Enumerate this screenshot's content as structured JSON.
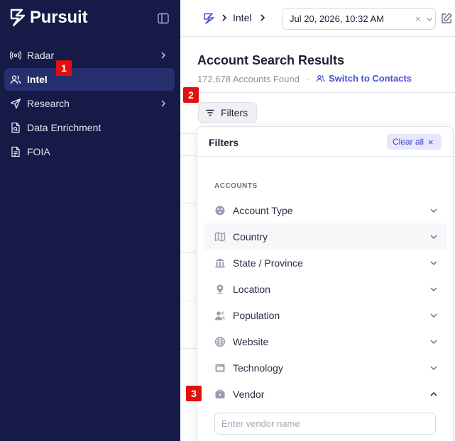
{
  "brand": {
    "name": "Pursuit"
  },
  "sidebar": {
    "items": [
      {
        "label": "Radar"
      },
      {
        "label": "Intel"
      },
      {
        "label": "Research"
      },
      {
        "label": "Data Enrichment"
      },
      {
        "label": "FOIA"
      }
    ]
  },
  "topbar": {
    "breadcrumb": "Intel",
    "date_value": "Jul 20, 2026, 10:32 AM",
    "date_clear": "×"
  },
  "main": {
    "title": "Account Search Results",
    "count": "172,678 Accounts Found",
    "separator": "·",
    "switch_link": "Switch to Contacts",
    "filters_button": "Filters"
  },
  "panel": {
    "title": "Filters",
    "clear_all": "Clear all",
    "clear_icon": "×",
    "section": "ACCOUNTS",
    "rows": [
      {
        "label": "Account Type",
        "icon": "account-type-icon"
      },
      {
        "label": "Country",
        "icon": "map-icon"
      },
      {
        "label": "State / Province",
        "icon": "building-icon"
      },
      {
        "label": "Location",
        "icon": "location-pin-icon"
      },
      {
        "label": "Population",
        "icon": "population-icon"
      },
      {
        "label": "Website",
        "icon": "globe-icon"
      },
      {
        "label": "Technology",
        "icon": "technology-icon"
      },
      {
        "label": "Vendor",
        "icon": "briefcase-icon"
      }
    ],
    "vendor_placeholder": "Enter vendor name"
  },
  "badges": [
    "1",
    "2",
    "3"
  ],
  "colors": {
    "sidebar_bg": "#151a46",
    "active_item": "#262f6e",
    "accent": "#4450d6",
    "badge": "#e01010"
  }
}
